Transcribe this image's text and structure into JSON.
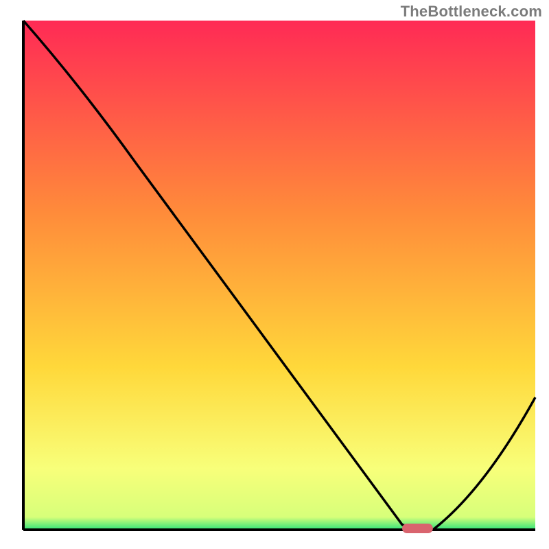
{
  "watermark": "TheBottleneck.com",
  "chart_data": {
    "type": "line",
    "title": "",
    "xlabel": "",
    "ylabel": "",
    "x_range": [
      0,
      100
    ],
    "y_range": [
      0,
      100
    ],
    "gradient_colors": {
      "top": "#ff2a55",
      "mid_upper": "#ff8c3a",
      "mid": "#ffd83a",
      "lower": "#f8ff7a",
      "bottom": "#2fe37a"
    },
    "axis_color": "#000000",
    "curve": {
      "description": "Bottleneck percentage curve; starts at 100 on left, drops to 0 near x≈78, rises back toward ~30% at x=100",
      "x": [
        0,
        22,
        74,
        80,
        100
      ],
      "y": [
        100,
        72,
        1,
        0,
        26
      ]
    },
    "marker": {
      "description": "Optimal-point capsule on x-axis",
      "x_center": 77,
      "width": 6,
      "color": "#d9646e"
    }
  }
}
